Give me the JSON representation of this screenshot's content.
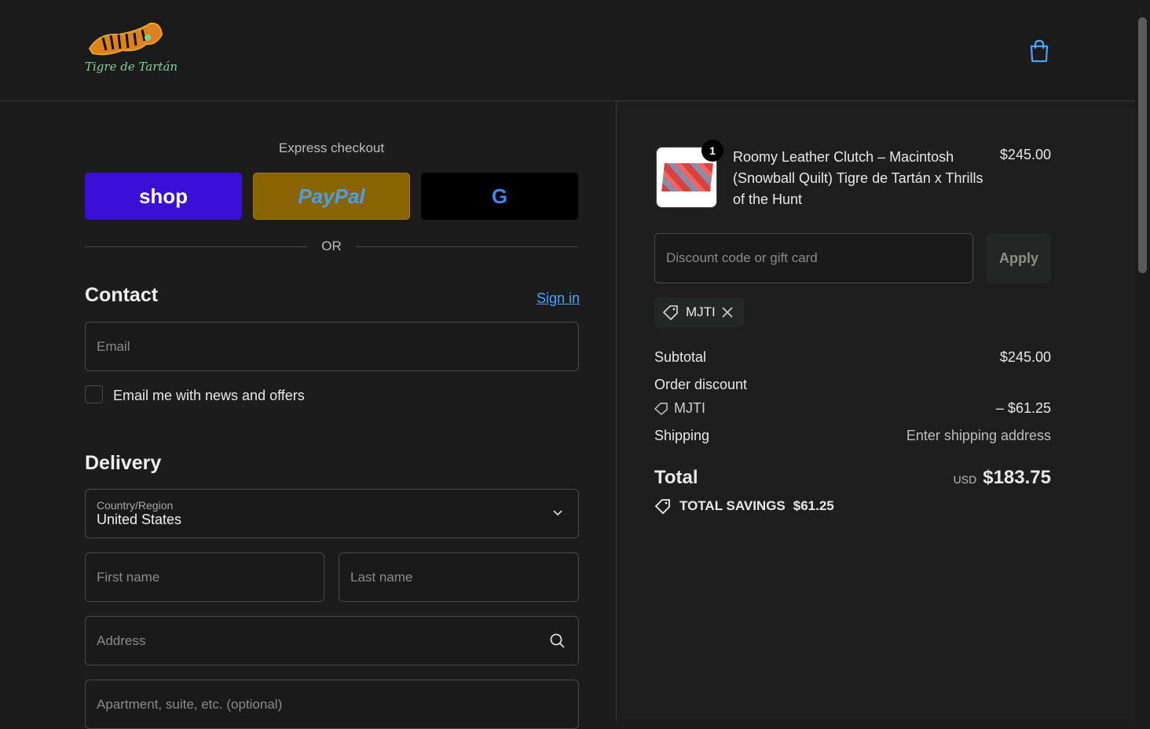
{
  "header": {
    "logo_text": "Tigre de Tartán"
  },
  "express": {
    "title": "Express checkout",
    "shop_label": "shop",
    "paypal_label": "PayPal",
    "google_label": "G",
    "or_label": "OR"
  },
  "contact": {
    "title": "Contact",
    "sign_in": "Sign in",
    "email_placeholder": "Email",
    "news_label": "Email me with news and offers"
  },
  "delivery": {
    "title": "Delivery",
    "country_label": "Country/Region",
    "country_value": "United States",
    "first_name": "First name",
    "last_name": "Last name",
    "address": "Address",
    "apartment": "Apartment, suite, etc. (optional)"
  },
  "summary": {
    "item": {
      "qty": "1",
      "name": "Roomy Leather Clutch – Macintosh (Snowball Quilt) Tigre de Tartán x Thrills of the Hunt",
      "price": "$245.00"
    },
    "discount_placeholder": "Discount code or gift card",
    "apply": "Apply",
    "code": "MJTI",
    "subtotal_label": "Subtotal",
    "subtotal": "$245.00",
    "order_discount_label": "Order discount",
    "discount_amount": "– $61.25",
    "shipping_label": "Shipping",
    "shipping_value": "Enter shipping address",
    "total_label": "Total",
    "currency": "USD",
    "total": "$183.75",
    "savings_label": "TOTAL SAVINGS",
    "savings": "$61.25"
  }
}
